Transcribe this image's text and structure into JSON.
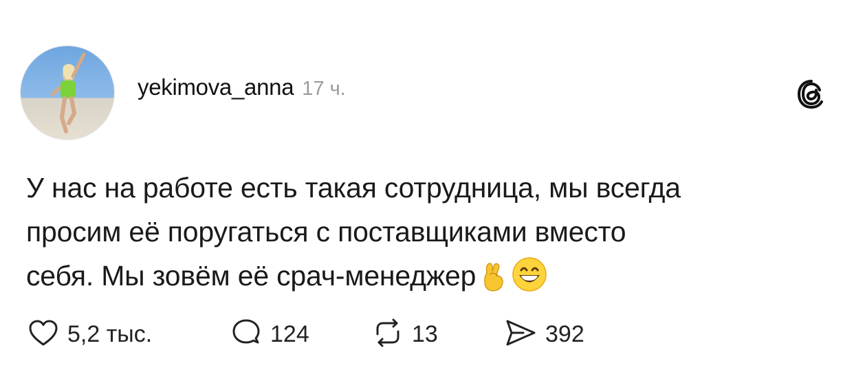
{
  "post": {
    "author": {
      "username": "yekimova_anna",
      "avatar_icon": "avatar-photo"
    },
    "timestamp": "17 ч.",
    "app_logo_icon": "threads-logo-icon",
    "text_lines": [
      "У нас на работе есть такая сотрудница, мы всегда",
      "просим её поругаться с поставщиками вместо",
      "себя. Мы зовём её срач-менеджер"
    ],
    "trailing_emojis": [
      "crossed-fingers-emoji",
      "grinning-face-emoji"
    ]
  },
  "actions": {
    "likes": {
      "icon": "heart-icon",
      "count": "5,2 тыс."
    },
    "replies": {
      "icon": "comment-icon",
      "count": "124"
    },
    "reposts": {
      "icon": "repost-icon",
      "count": "13"
    },
    "shares": {
      "icon": "send-icon",
      "count": "392"
    }
  }
}
